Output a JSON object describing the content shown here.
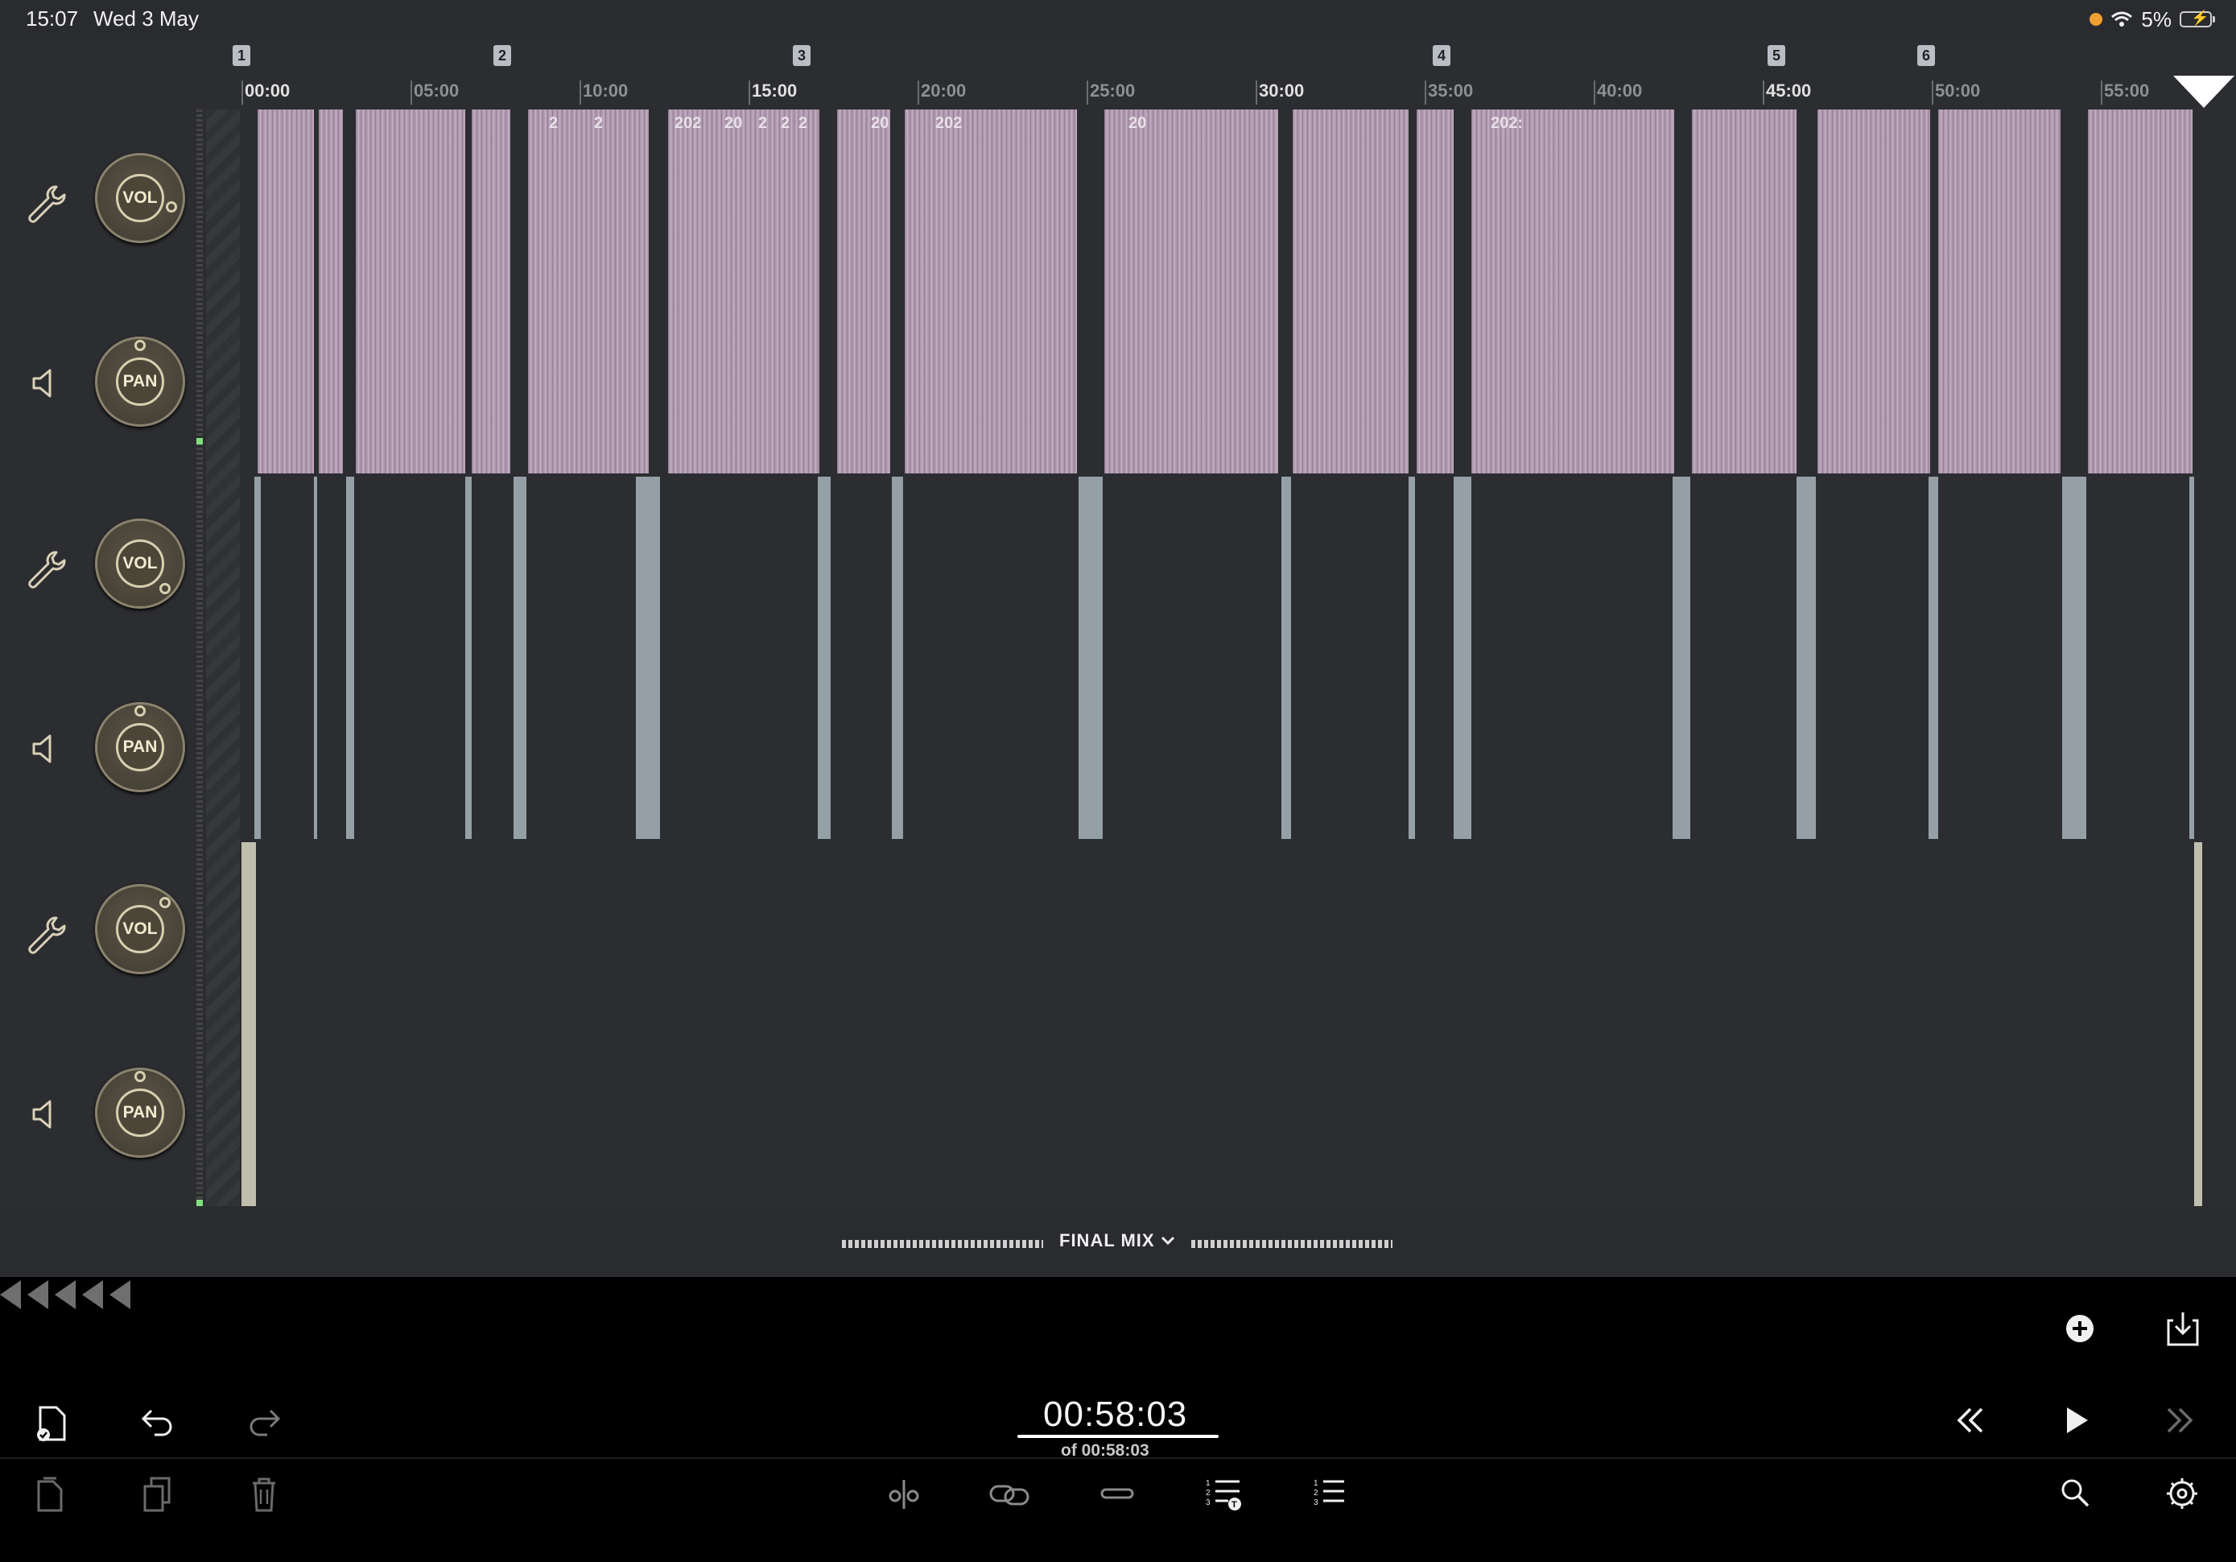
{
  "status_bar": {
    "time": "15:07",
    "date": "Wed 3 May",
    "battery": "5%"
  },
  "ruler": {
    "markers": [
      "1",
      "2",
      "3",
      "4",
      "5",
      "6"
    ],
    "ticks": [
      "00:00",
      "05:00",
      "10:00",
      "15:00",
      "20:00",
      "25:00",
      "30:00",
      "35:00",
      "40:00",
      "45:00",
      "50:00",
      "55:00"
    ]
  },
  "tracks": [
    {
      "vol_label": "VOL",
      "pan_label": "PAN",
      "icons": [
        "wrench-icon",
        "speaker-icon"
      ]
    },
    {
      "vol_label": "VOL",
      "pan_label": "PAN",
      "icons": [
        "wrench-icon",
        "speaker-icon"
      ]
    },
    {
      "vol_label": "VOL",
      "pan_label": "PAN",
      "icons": [
        "wrench-icon",
        "speaker-icon"
      ]
    }
  ],
  "clips_track1_labels": [
    "2",
    "2",
    "202",
    "20",
    "2",
    "2",
    "2",
    "20",
    "202",
    "20",
    "202:"
  ],
  "mix_bar": {
    "label": "FINAL MIX"
  },
  "transport": {
    "current_time": "00:58:03",
    "total_time": "of 00:58:03"
  },
  "colors": {
    "track1_clip": "#b19ab1",
    "track2_clip": "#95a0a6",
    "track3_clip": "#c0bfae",
    "knob_ring": "#d8cfb0",
    "background": "#2c2d30"
  },
  "toolbar_icons": [
    "document-check-icon",
    "undo-icon",
    "redo-icon",
    "copy-icon",
    "paste-icon",
    "trash-icon",
    "split-icon",
    "link-icon",
    "fade-icon",
    "markers-list-icon",
    "list-icon",
    "search-icon",
    "settings-icon",
    "add-icon",
    "export-icon",
    "rewind-icon",
    "play-icon",
    "fast-forward-icon"
  ]
}
